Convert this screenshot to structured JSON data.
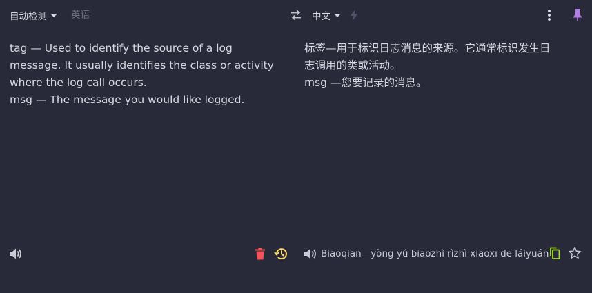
{
  "source": {
    "language_label": "自动检测",
    "detected_language": "英语",
    "text_lines": [
      "tag — Used to identify the source of a log",
      "message. It usually identifies the class or activity",
      "where the log call occurs.",
      "msg — The message you would like logged."
    ]
  },
  "target": {
    "language_label": "中文",
    "text_lines": [
      "标签—用于标识日志消息的来源。它通常标识发生日",
      "志调用的类或活动。",
      "msg —您要记录的消息。"
    ],
    "romanization": "Biāoqiān—yòng yú biāozhì rìzhì xiāoxī de láiyuán"
  },
  "icons": {
    "swap": "swap-icon",
    "lightning": "lightning-icon",
    "more": "more-vertical-icon",
    "pin": "pin-icon",
    "speaker_source": "speaker-icon",
    "delete": "trash-icon",
    "history": "history-icon",
    "speaker_target": "speaker-icon",
    "copy": "copy-icon",
    "favorite": "star-icon"
  },
  "colors": {
    "background": "#282a3a",
    "text": "#d6d8e0",
    "muted": "#6f7283",
    "pin_accent": "#b57ee5",
    "delete_accent": "#f2545b",
    "history_accent": "#ffd76a",
    "copy_accent": "#a6e22e"
  }
}
